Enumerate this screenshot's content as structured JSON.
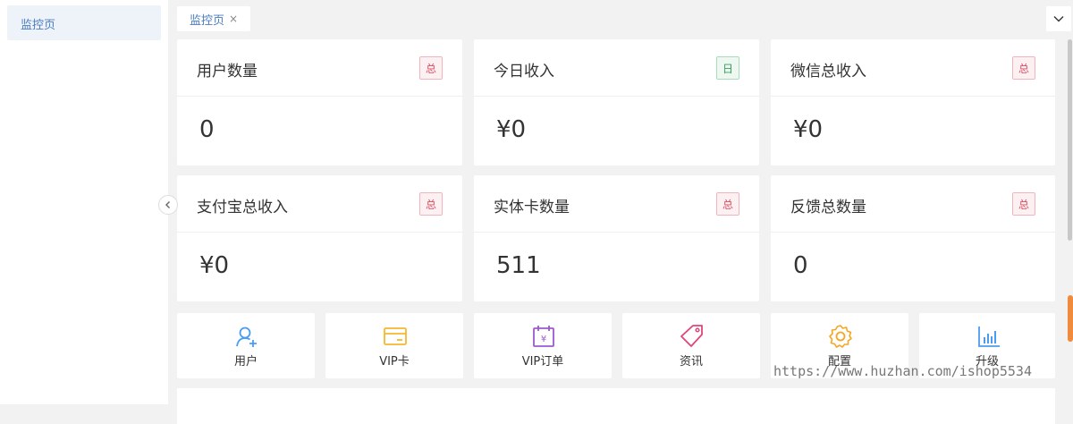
{
  "sidebar": {
    "items": [
      {
        "label": "监控页"
      }
    ]
  },
  "tabs": [
    {
      "label": "监控页",
      "close": "×"
    }
  ],
  "stat_cards": [
    {
      "title": "用户数量",
      "badge": "总",
      "value": "0"
    },
    {
      "title": "今日收入",
      "badge": "日",
      "value": "¥0"
    },
    {
      "title": "微信总收入",
      "badge": "总",
      "value": "¥0"
    },
    {
      "title": "支付宝总收入",
      "badge": "总",
      "value": "¥0"
    },
    {
      "title": "实体卡数量",
      "badge": "总",
      "value": "511"
    },
    {
      "title": "反馈总数量",
      "badge": "总",
      "value": "0"
    }
  ],
  "quick_links": [
    {
      "label": "用户",
      "icon": "user-add-icon",
      "color": "#4a9cf0"
    },
    {
      "label": "VIP卡",
      "icon": "card-icon",
      "color": "#f5b82e"
    },
    {
      "label": "VIP订单",
      "icon": "order-icon",
      "color": "#9b59d0"
    },
    {
      "label": "资讯",
      "icon": "tag-icon",
      "color": "#e0457b"
    },
    {
      "label": "配置",
      "icon": "gear-icon",
      "color": "#f5a623"
    },
    {
      "label": "升级",
      "icon": "bar-chart-icon",
      "color": "#4a9cf0"
    }
  ],
  "watermark": "https://www.huzhan.com/ishop5534",
  "colors": {
    "accent": "#4a7cc0",
    "badge_red": "#d64f62",
    "badge_green": "#3a9c60",
    "scroll_accent": "#f08a3c"
  }
}
